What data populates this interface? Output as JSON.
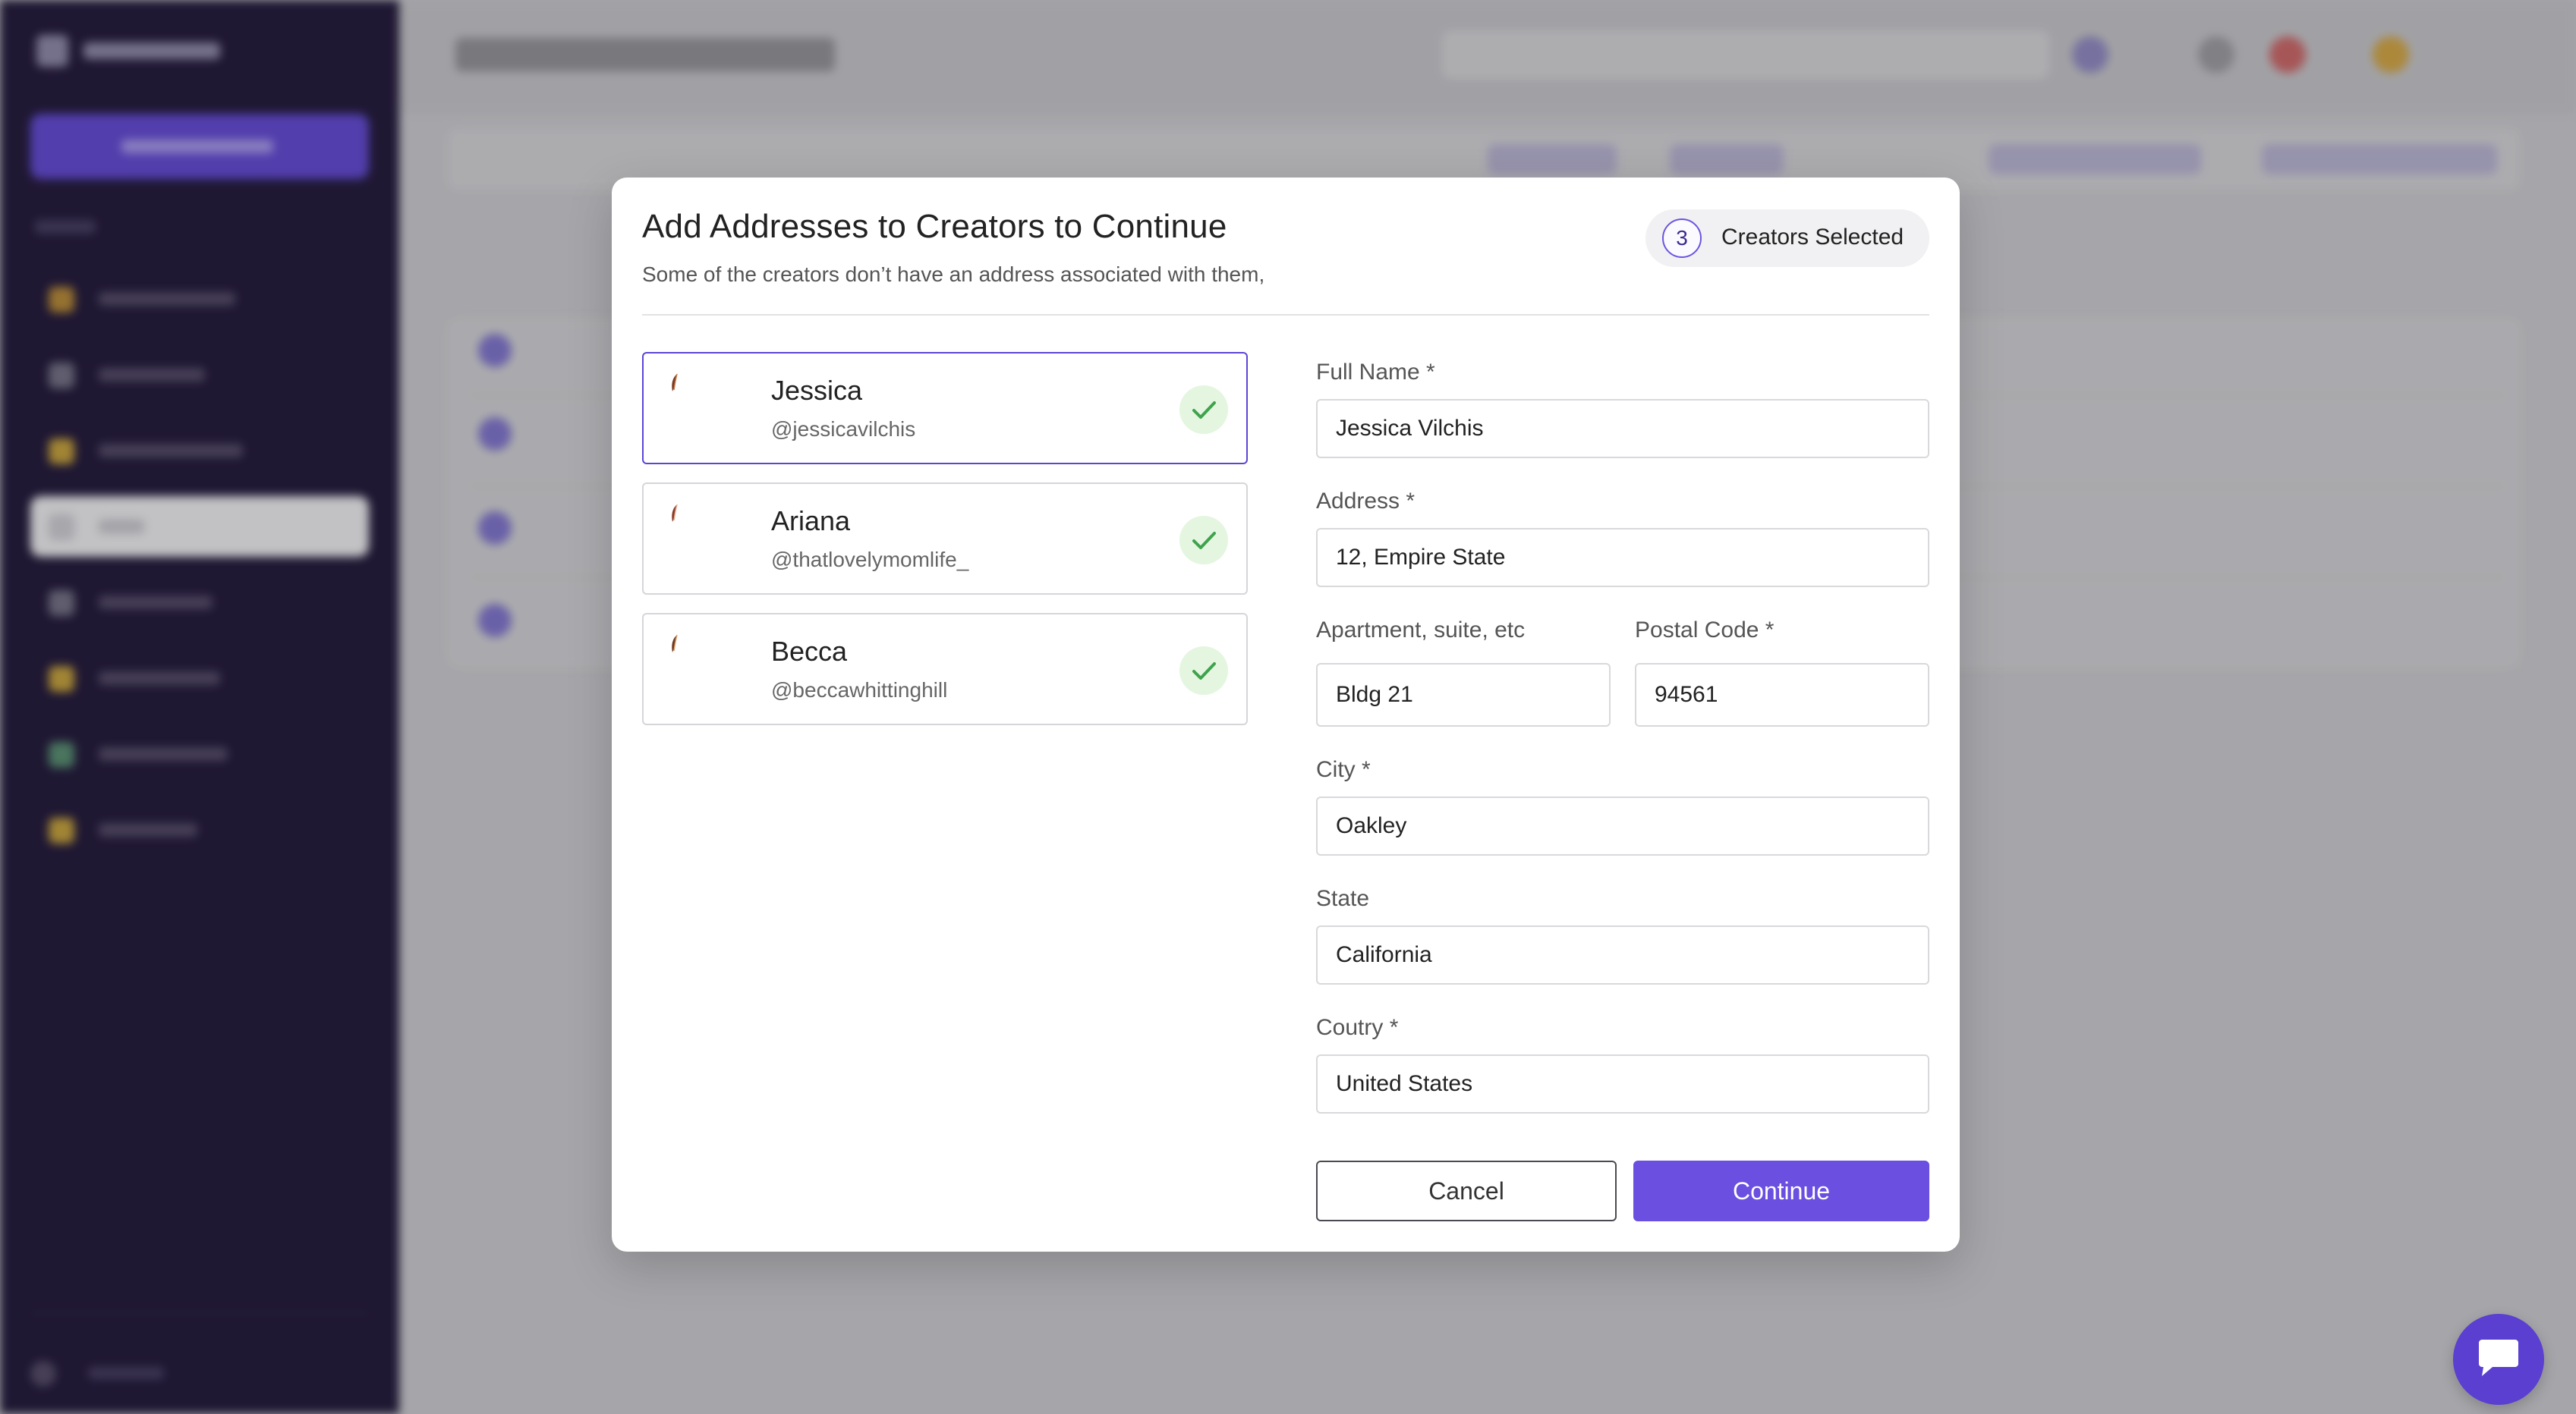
{
  "modal": {
    "title": "Add Addresses to Creators to Continue",
    "subtitle": "Some of the creators don’t have an address associated with them,",
    "selected_count": "3",
    "selected_label": "Creators Selected"
  },
  "creators": [
    {
      "name": "Jessica",
      "handle": "@jessicavilchis",
      "selected": true
    },
    {
      "name": "Ariana",
      "handle": "@thatlovelymomlife_",
      "selected": false
    },
    {
      "name": "Becca",
      "handle": "@beccawhittinghill",
      "selected": false
    }
  ],
  "form": {
    "full_name": {
      "label": "Full Name *",
      "value": "Jessica Vilchis"
    },
    "address": {
      "label": "Address *",
      "value": "12, Empire State"
    },
    "apartment": {
      "label": "Apartment, suite, etc",
      "value": "Bldg 21"
    },
    "postal_code": {
      "label": "Postal Code *",
      "value": "94561"
    },
    "city": {
      "label": "City *",
      "value": "Oakley"
    },
    "state": {
      "label": "State",
      "value": "California"
    },
    "country": {
      "label": "Coutry *",
      "value": "United States"
    }
  },
  "actions": {
    "cancel_label": "Cancel",
    "continue_label": "Continue"
  },
  "colors": {
    "accent": "#6a4fe0",
    "sidebar_bg": "#140a2e",
    "check_green": "#3fa34d"
  },
  "icons": {
    "creator_check": "check-icon",
    "chat": "chat-icon"
  }
}
